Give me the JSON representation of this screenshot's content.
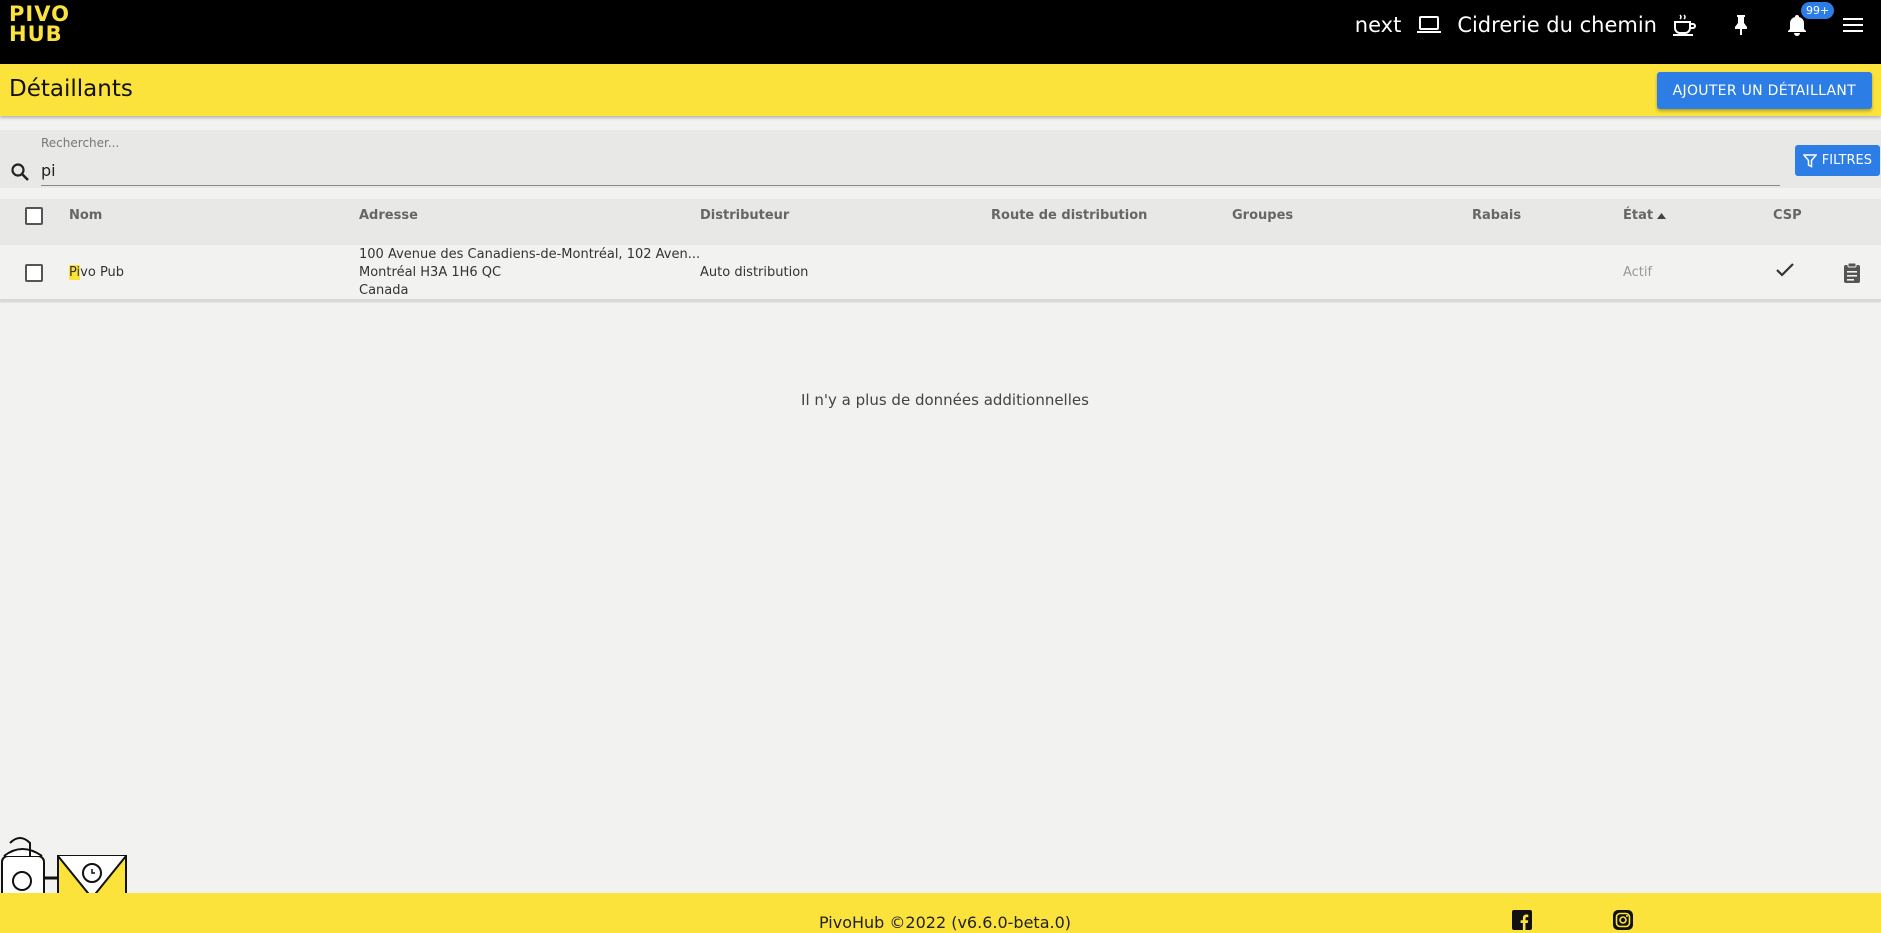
{
  "header": {
    "logo_line1": "PIVO",
    "logo_line2": "HUB",
    "env": "next",
    "org": "Cidrerie du chemin",
    "notif_count": "99+"
  },
  "page": {
    "title": "Détaillants",
    "add_label": "AJOUTER UN DÉTAILLANT"
  },
  "search": {
    "label": "Rechercher...",
    "value": "pi",
    "filters_label": "FILTRES"
  },
  "table": {
    "columns": [
      "Nom",
      "Adresse",
      "Distributeur",
      "Route de distribution",
      "Groupes",
      "Rabais",
      "État",
      "CSP"
    ],
    "rows": [
      {
        "name_highlight": "Pi",
        "name_rest": "vo Pub",
        "address_line1": "100 Avenue des Canadiens-de-Montréal, 102 Aven...",
        "address_line2": "Montréal H3A 1H6 QC",
        "address_line3": "Canada",
        "distributor": "Auto distribution",
        "route": "",
        "groups": "",
        "discount": "",
        "state": "Actif",
        "csp": true
      }
    ],
    "no_more": "Il n'y a plus de données additionnelles"
  },
  "footer": {
    "text": "PivoHub ©2022 (v6.6.0-beta.0)"
  },
  "colors": {
    "brand_yellow": "#fce33b",
    "accent_blue": "#2c7ee6"
  }
}
